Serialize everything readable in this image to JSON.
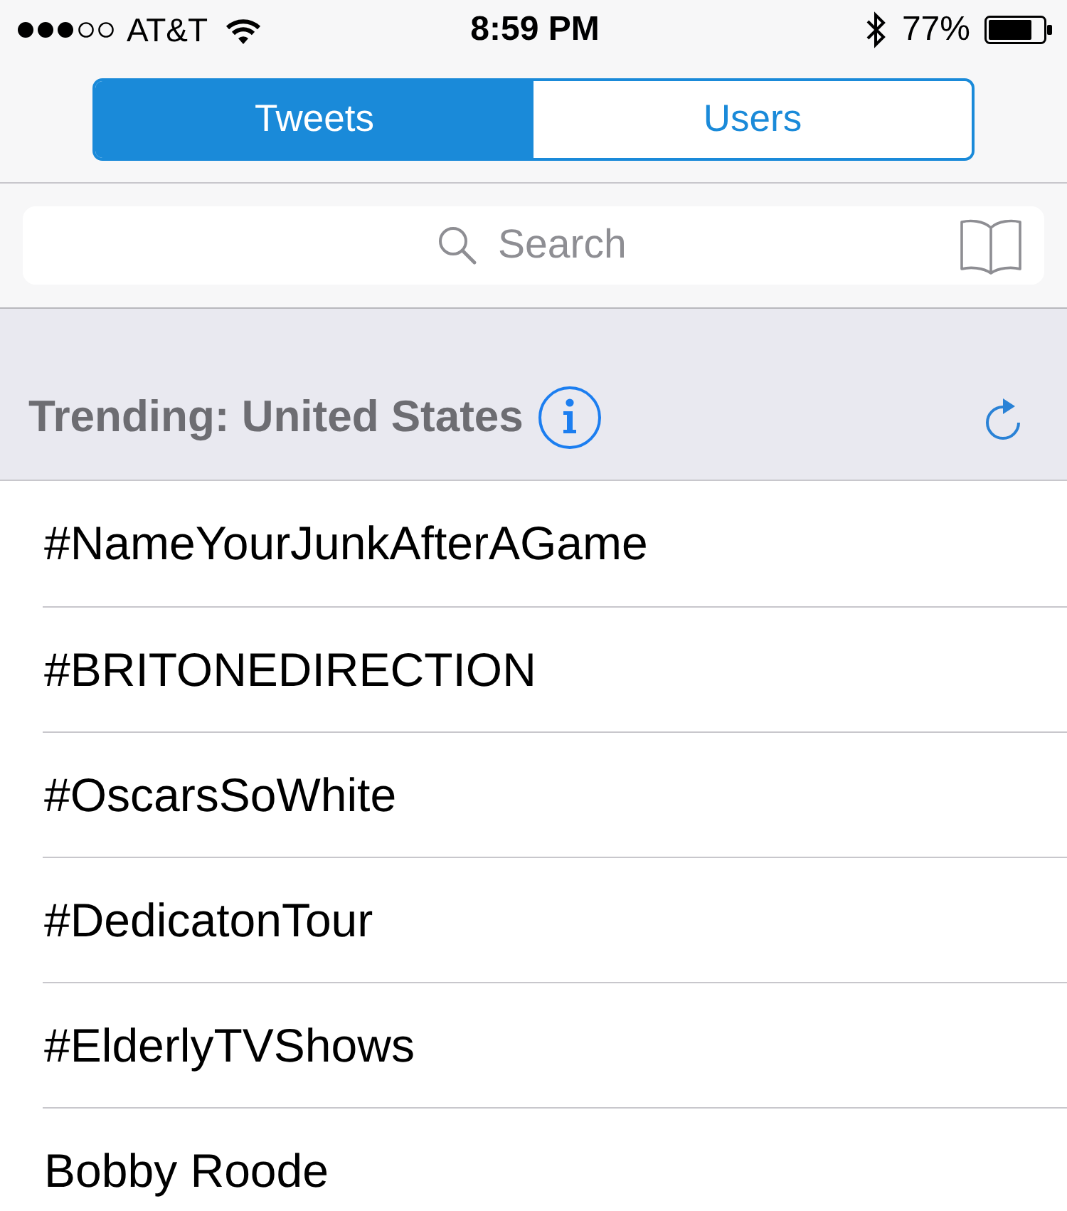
{
  "status_bar": {
    "carrier": "AT&T",
    "time": "8:59 PM",
    "battery": "77%"
  },
  "segments": [
    {
      "label": "Tweets",
      "selected": true
    },
    {
      "label": "Users",
      "selected": false
    }
  ],
  "search": {
    "placeholder": "Search"
  },
  "trending": {
    "title": "Trending: United States",
    "items": [
      "#NameYourJunkAfterAGame",
      "#BRITONEDIRECTION",
      "#OscarsSoWhite",
      "#DedicatonTour",
      "#ElderlyTVShows",
      "Bobby Roode"
    ]
  }
}
